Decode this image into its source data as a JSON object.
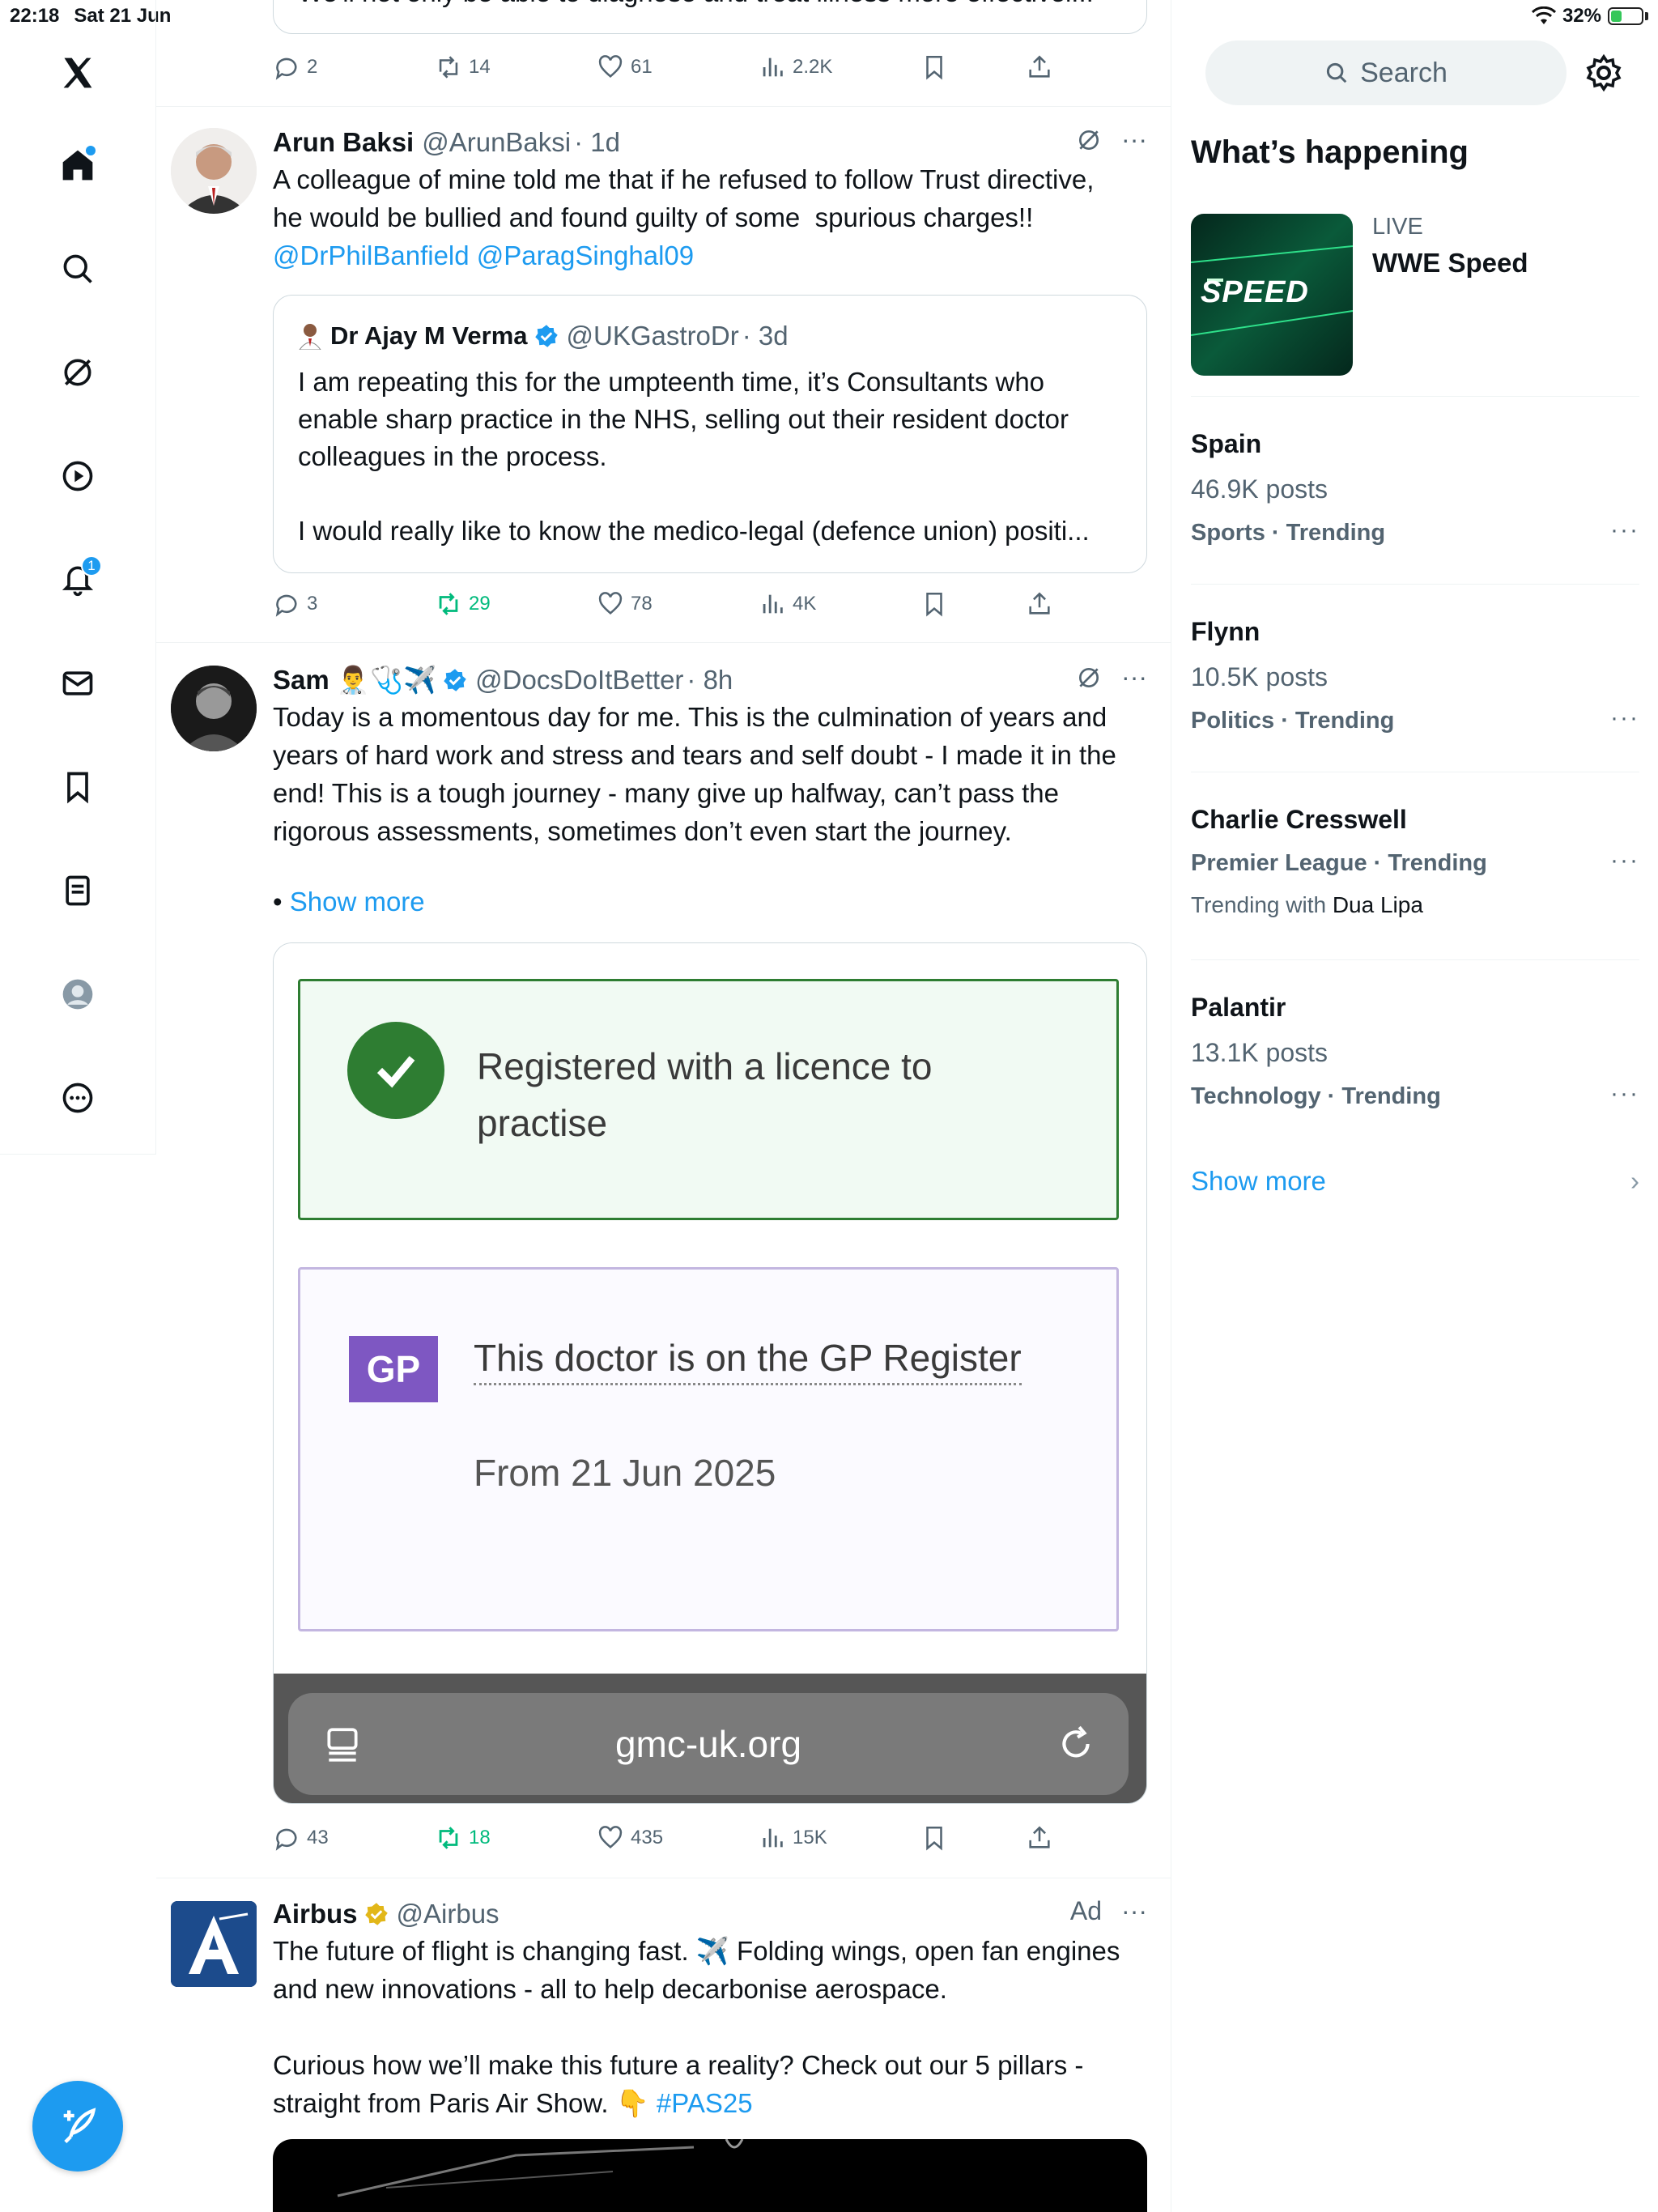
{
  "status_bar": {
    "time": "22:18",
    "date": "Sat 21 Jun",
    "battery": "32%"
  },
  "sidebar": {
    "notifications_badge": "1"
  },
  "top_tweet": {
    "partial_text": "We'll not only be able to diagnose and treat illness more effectivel...",
    "replies": "2",
    "reposts": "14",
    "likes": "61",
    "views": "2.2K"
  },
  "tweet1": {
    "name": "Arun Baksi",
    "handle": "@ArunBaksi",
    "time": "· 1d",
    "text": "A colleague of mine told me that if he refused to follow Trust directive,\nhe would be bullied and found guilty of some  spurious charges!!",
    "mentions": "@DrPhilBanfield @ParagSinghal09",
    "quote": {
      "name": "Dr Ajay M Verma",
      "handle": "@UKGastroDr",
      "time": "· 3d",
      "text": "I am repeating this for the umpteenth time, it’s Consultants who\nenable sharp practice in the NHS, selling out their resident doctor\ncolleagues in the process.\n\nI would really like to know the medico-legal (defence union) positi..."
    },
    "replies": "3",
    "reposts": "29",
    "likes": "78",
    "views": "4K"
  },
  "tweet2": {
    "name": "Sam 👨‍⚕️🩺✈️",
    "handle": "@DocsDoItBetter",
    "time": "· 8h",
    "text": "Today is a momentous day for me. This is the culmination of years and\nyears of hard work and stress and tears and self doubt - I made it in the\nend! This is a tough journey - many give up halfway, can’t pass the\nrigorous assessments, sometimes don’t even start the journey.",
    "show_more": "Show more",
    "card": {
      "licence_text": "Registered with a licence to\npractise",
      "gp_badge": "GP",
      "gp_text": "This doctor is on the GP Register",
      "gp_from": "From 21 Jun 2025",
      "url": "gmc-uk.org"
    },
    "replies": "43",
    "reposts": "18",
    "likes": "435",
    "views": "15K"
  },
  "tweet3": {
    "name": "Airbus",
    "handle": "@Airbus",
    "ad_label": "Ad",
    "text": "The future of flight is changing fast. ✈️ Folding wings, open fan engines\nand new innovations - all to help decarbonise aerospace.\n\nCurious how we’ll make this future a reality? Check out our 5 pillars -\nstraight from Paris Air Show. 👇 ",
    "hashtag": "#PAS25"
  },
  "right": {
    "search_placeholder": "Search",
    "heading": "What’s happening",
    "live": {
      "label": "LIVE",
      "title": "WWE Speed",
      "thumb_text": "SPEED"
    },
    "trends": [
      {
        "name": "Spain",
        "count": "46.9K posts",
        "category": "Sports · Trending"
      },
      {
        "name": "Flynn",
        "count": "10.5K posts",
        "category": "Politics · Trending"
      },
      {
        "name": "Charlie Cresswell",
        "category": "Premier League · Trending",
        "with_label": "Trending with",
        "with_name": "Dua Lipa"
      },
      {
        "name": "Palantir",
        "count": "13.1K posts",
        "category": "Technology · Trending"
      }
    ],
    "show_more": "Show more"
  },
  "colors": {
    "accent": "#1d9bf0",
    "repost_active": "#00ba7c",
    "gp_purple": "#7e57c2",
    "success_green": "#2e7d32"
  }
}
